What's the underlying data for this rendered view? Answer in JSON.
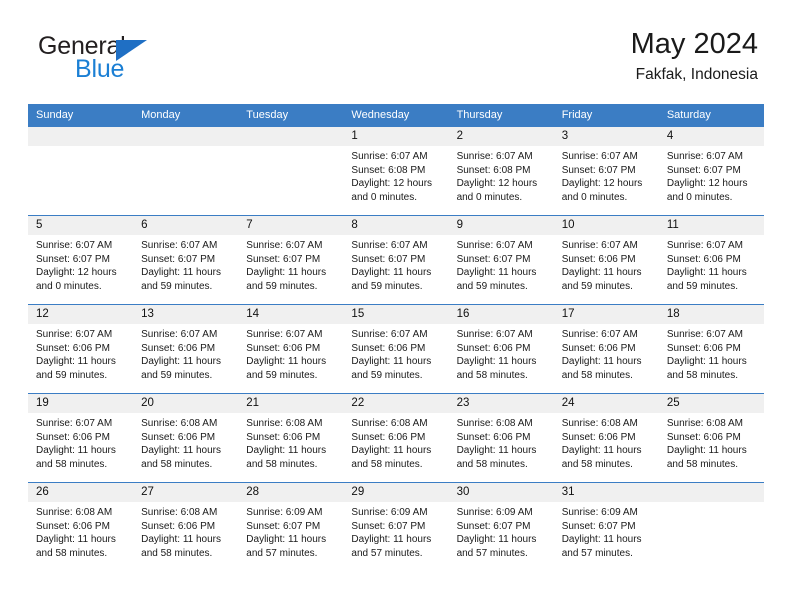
{
  "brand": {
    "name_part1": "General",
    "name_part2": "Blue",
    "logo_icon": "triangle-logo-icon",
    "colors": {
      "dark": "#231f20",
      "blue": "#1b7fd4",
      "header_blue": "#3b7dc4"
    }
  },
  "header": {
    "title": "May 2024",
    "subtitle": "Fakfak, Indonesia"
  },
  "weekday_headers": [
    "Sunday",
    "Monday",
    "Tuesday",
    "Wednesday",
    "Thursday",
    "Friday",
    "Saturday"
  ],
  "weeks": [
    [
      {
        "day": "",
        "sunrise": "",
        "sunset": "",
        "daylight_line1": "",
        "daylight_line2": "",
        "empty": true
      },
      {
        "day": "",
        "sunrise": "",
        "sunset": "",
        "daylight_line1": "",
        "daylight_line2": "",
        "empty": true
      },
      {
        "day": "",
        "sunrise": "",
        "sunset": "",
        "daylight_line1": "",
        "daylight_line2": "",
        "empty": true
      },
      {
        "day": "1",
        "sunrise": "Sunrise: 6:07 AM",
        "sunset": "Sunset: 6:08 PM",
        "daylight_line1": "Daylight: 12 hours",
        "daylight_line2": "and 0 minutes."
      },
      {
        "day": "2",
        "sunrise": "Sunrise: 6:07 AM",
        "sunset": "Sunset: 6:08 PM",
        "daylight_line1": "Daylight: 12 hours",
        "daylight_line2": "and 0 minutes."
      },
      {
        "day": "3",
        "sunrise": "Sunrise: 6:07 AM",
        "sunset": "Sunset: 6:07 PM",
        "daylight_line1": "Daylight: 12 hours",
        "daylight_line2": "and 0 minutes."
      },
      {
        "day": "4",
        "sunrise": "Sunrise: 6:07 AM",
        "sunset": "Sunset: 6:07 PM",
        "daylight_line1": "Daylight: 12 hours",
        "daylight_line2": "and 0 minutes."
      }
    ],
    [
      {
        "day": "5",
        "sunrise": "Sunrise: 6:07 AM",
        "sunset": "Sunset: 6:07 PM",
        "daylight_line1": "Daylight: 12 hours",
        "daylight_line2": "and 0 minutes."
      },
      {
        "day": "6",
        "sunrise": "Sunrise: 6:07 AM",
        "sunset": "Sunset: 6:07 PM",
        "daylight_line1": "Daylight: 11 hours",
        "daylight_line2": "and 59 minutes."
      },
      {
        "day": "7",
        "sunrise": "Sunrise: 6:07 AM",
        "sunset": "Sunset: 6:07 PM",
        "daylight_line1": "Daylight: 11 hours",
        "daylight_line2": "and 59 minutes."
      },
      {
        "day": "8",
        "sunrise": "Sunrise: 6:07 AM",
        "sunset": "Sunset: 6:07 PM",
        "daylight_line1": "Daylight: 11 hours",
        "daylight_line2": "and 59 minutes."
      },
      {
        "day": "9",
        "sunrise": "Sunrise: 6:07 AM",
        "sunset": "Sunset: 6:07 PM",
        "daylight_line1": "Daylight: 11 hours",
        "daylight_line2": "and 59 minutes."
      },
      {
        "day": "10",
        "sunrise": "Sunrise: 6:07 AM",
        "sunset": "Sunset: 6:06 PM",
        "daylight_line1": "Daylight: 11 hours",
        "daylight_line2": "and 59 minutes."
      },
      {
        "day": "11",
        "sunrise": "Sunrise: 6:07 AM",
        "sunset": "Sunset: 6:06 PM",
        "daylight_line1": "Daylight: 11 hours",
        "daylight_line2": "and 59 minutes."
      }
    ],
    [
      {
        "day": "12",
        "sunrise": "Sunrise: 6:07 AM",
        "sunset": "Sunset: 6:06 PM",
        "daylight_line1": "Daylight: 11 hours",
        "daylight_line2": "and 59 minutes."
      },
      {
        "day": "13",
        "sunrise": "Sunrise: 6:07 AM",
        "sunset": "Sunset: 6:06 PM",
        "daylight_line1": "Daylight: 11 hours",
        "daylight_line2": "and 59 minutes."
      },
      {
        "day": "14",
        "sunrise": "Sunrise: 6:07 AM",
        "sunset": "Sunset: 6:06 PM",
        "daylight_line1": "Daylight: 11 hours",
        "daylight_line2": "and 59 minutes."
      },
      {
        "day": "15",
        "sunrise": "Sunrise: 6:07 AM",
        "sunset": "Sunset: 6:06 PM",
        "daylight_line1": "Daylight: 11 hours",
        "daylight_line2": "and 59 minutes."
      },
      {
        "day": "16",
        "sunrise": "Sunrise: 6:07 AM",
        "sunset": "Sunset: 6:06 PM",
        "daylight_line1": "Daylight: 11 hours",
        "daylight_line2": "and 58 minutes."
      },
      {
        "day": "17",
        "sunrise": "Sunrise: 6:07 AM",
        "sunset": "Sunset: 6:06 PM",
        "daylight_line1": "Daylight: 11 hours",
        "daylight_line2": "and 58 minutes."
      },
      {
        "day": "18",
        "sunrise": "Sunrise: 6:07 AM",
        "sunset": "Sunset: 6:06 PM",
        "daylight_line1": "Daylight: 11 hours",
        "daylight_line2": "and 58 minutes."
      }
    ],
    [
      {
        "day": "19",
        "sunrise": "Sunrise: 6:07 AM",
        "sunset": "Sunset: 6:06 PM",
        "daylight_line1": "Daylight: 11 hours",
        "daylight_line2": "and 58 minutes."
      },
      {
        "day": "20",
        "sunrise": "Sunrise: 6:08 AM",
        "sunset": "Sunset: 6:06 PM",
        "daylight_line1": "Daylight: 11 hours",
        "daylight_line2": "and 58 minutes."
      },
      {
        "day": "21",
        "sunrise": "Sunrise: 6:08 AM",
        "sunset": "Sunset: 6:06 PM",
        "daylight_line1": "Daylight: 11 hours",
        "daylight_line2": "and 58 minutes."
      },
      {
        "day": "22",
        "sunrise": "Sunrise: 6:08 AM",
        "sunset": "Sunset: 6:06 PM",
        "daylight_line1": "Daylight: 11 hours",
        "daylight_line2": "and 58 minutes."
      },
      {
        "day": "23",
        "sunrise": "Sunrise: 6:08 AM",
        "sunset": "Sunset: 6:06 PM",
        "daylight_line1": "Daylight: 11 hours",
        "daylight_line2": "and 58 minutes."
      },
      {
        "day": "24",
        "sunrise": "Sunrise: 6:08 AM",
        "sunset": "Sunset: 6:06 PM",
        "daylight_line1": "Daylight: 11 hours",
        "daylight_line2": "and 58 minutes."
      },
      {
        "day": "25",
        "sunrise": "Sunrise: 6:08 AM",
        "sunset": "Sunset: 6:06 PM",
        "daylight_line1": "Daylight: 11 hours",
        "daylight_line2": "and 58 minutes."
      }
    ],
    [
      {
        "day": "26",
        "sunrise": "Sunrise: 6:08 AM",
        "sunset": "Sunset: 6:06 PM",
        "daylight_line1": "Daylight: 11 hours",
        "daylight_line2": "and 58 minutes."
      },
      {
        "day": "27",
        "sunrise": "Sunrise: 6:08 AM",
        "sunset": "Sunset: 6:06 PM",
        "daylight_line1": "Daylight: 11 hours",
        "daylight_line2": "and 58 minutes."
      },
      {
        "day": "28",
        "sunrise": "Sunrise: 6:09 AM",
        "sunset": "Sunset: 6:07 PM",
        "daylight_line1": "Daylight: 11 hours",
        "daylight_line2": "and 57 minutes."
      },
      {
        "day": "29",
        "sunrise": "Sunrise: 6:09 AM",
        "sunset": "Sunset: 6:07 PM",
        "daylight_line1": "Daylight: 11 hours",
        "daylight_line2": "and 57 minutes."
      },
      {
        "day": "30",
        "sunrise": "Sunrise: 6:09 AM",
        "sunset": "Sunset: 6:07 PM",
        "daylight_line1": "Daylight: 11 hours",
        "daylight_line2": "and 57 minutes."
      },
      {
        "day": "31",
        "sunrise": "Sunrise: 6:09 AM",
        "sunset": "Sunset: 6:07 PM",
        "daylight_line1": "Daylight: 11 hours",
        "daylight_line2": "and 57 minutes."
      },
      {
        "day": "",
        "sunrise": "",
        "sunset": "",
        "daylight_line1": "",
        "daylight_line2": "",
        "empty": true
      }
    ]
  ]
}
